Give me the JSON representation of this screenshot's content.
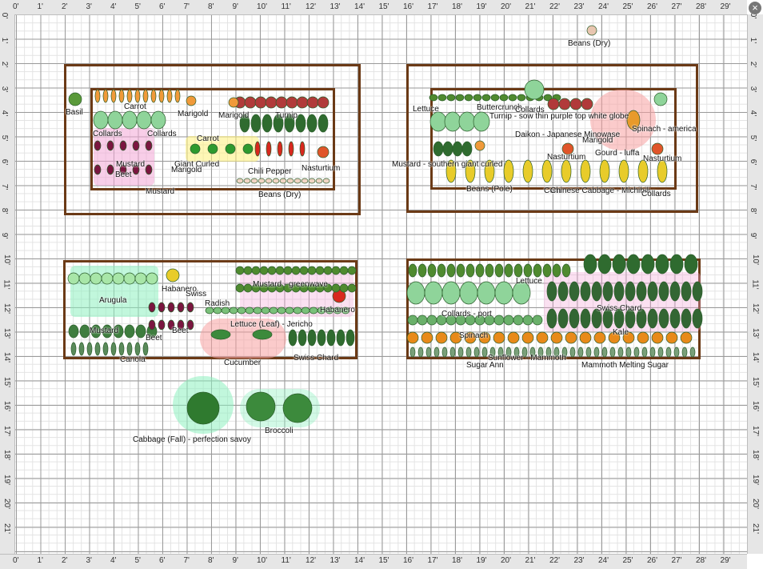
{
  "rulers": {
    "feet": [
      "0'",
      "1'",
      "2'",
      "3'",
      "4'",
      "5'",
      "6'",
      "7'",
      "8'",
      "9'",
      "10'",
      "11'",
      "12'",
      "13'",
      "14'",
      "15'",
      "16'",
      "17'",
      "18'",
      "19'",
      "20'",
      "21'",
      "22'",
      "23'",
      "24'",
      "25'",
      "26'",
      "27'",
      "28'",
      "29'"
    ],
    "vfeet": [
      "0'",
      "1'",
      "2'",
      "3'",
      "4'",
      "5'",
      "6'",
      "7'",
      "8'",
      "9'",
      "10'",
      "11'",
      "12'",
      "13'",
      "14'",
      "15'",
      "16'",
      "17'",
      "18'",
      "19'",
      "20'",
      "21'"
    ]
  },
  "close_label": "×",
  "labels": {
    "beans_dry_top": "Beans (Dry)",
    "basil": "Basil",
    "carrot1": "Carrot",
    "marigold1": "Marigold",
    "marigold2": "Marigold",
    "turnip": "Turnip",
    "collards1": "Collards",
    "collards2": "Collards",
    "carrot2": "Carrot",
    "giant_curled": "Giant Curled",
    "mustard1": "Mustard",
    "beet1": "Beet",
    "marigold3": "Marigold",
    "mustard2": "Mustard",
    "chili_pepper": "Chili Pepper",
    "nasturtium1": "Nasturtium",
    "beans_dry": "Beans (Dry)",
    "lettuce1": "Lettuce",
    "buttercrunch": "Buttercrunch",
    "collards3": "Collards",
    "turnip_sow": "Turnip - sow thin purple top white globe",
    "spinach": "Spinach - america",
    "daikon": "Daikon - Japanese Minowase",
    "marigold4": "Marigold",
    "gourd": "Gourd - luffa",
    "nasturtium2": "Nasturtium",
    "nasturtium3": "Nasturtium",
    "mustard_sg": "Mustard - southern giant curled",
    "beans_pole": "Beans (Pole)",
    "corn": "Corn",
    "chinese_cabbage": "Chinese Cabbage - Michihili",
    "collards4": "Collards",
    "arugula": "Arugula",
    "habanero1": "Habanero",
    "swiss": "Swiss",
    "radish": "Radish",
    "mustard_greenwave": "Mustard - greenwave",
    "habanero2": "Habanero",
    "mustard3": "Mustard",
    "beet2": "Beet",
    "beet3": "Beet",
    "lettuce_leaf": "Lettuce (Leaf) - Jericho",
    "canola": "Canola",
    "cucumber": "Cucumber",
    "swiss_chard1": "Swiss Chard",
    "lettuce2": "Lettuce",
    "collards_port": "Collards - port",
    "swiss_chard2": "Swiss Chard",
    "kale": "Kale",
    "spinach2": "Spinach",
    "sunflower_mammoth": "Sunflower - Mammoth",
    "sugar_ann": "Sugar Ann",
    "mammoth_melting": "Mammoth Melting Sugar",
    "cabbage_fall": "Cabbage (Fall) - perfection savoy",
    "broccoli": "Broccoli"
  },
  "colors": {
    "bed_border": "#6b3a16",
    "pink_zone": "#f3a6d6",
    "green_zone": "#8ef0c0",
    "yellow_zone": "#fff07a",
    "red_zone": "#f7a1a1",
    "leaf": "#3f9a3f",
    "leaf_light": "#8fd49a",
    "beet": "#7a1640",
    "corn": "#e8cc2a",
    "carrot": "#f09a3a",
    "pepper_red": "#d8281e"
  }
}
